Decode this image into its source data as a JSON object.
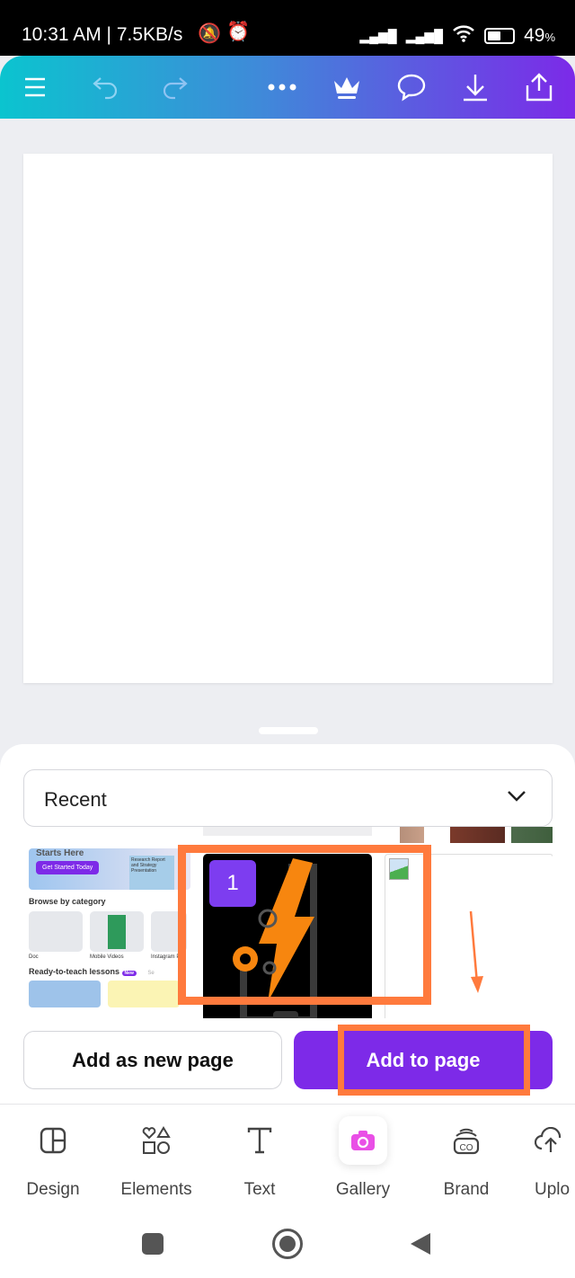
{
  "status_bar": {
    "time": "10:31 AM | 7.5KB/s",
    "battery": "49",
    "battery_unit": "%"
  },
  "toolbar": {
    "icons": [
      "menu-icon",
      "undo-icon",
      "redo-icon",
      "more-icon",
      "crown-icon",
      "comment-icon",
      "download-icon",
      "share-icon"
    ]
  },
  "panel": {
    "dropdown_value": "Recent",
    "thumb1": {
      "heading": "Starts Here",
      "cta": "Get Started Today",
      "card_text": "Research Report and Strategy Presentation",
      "browse": "Browse by category",
      "categories": [
        "Doc",
        "Mobile Videos",
        "Instagram Po"
      ],
      "lessons": "Ready-to-teach lessons",
      "lessons_badge": "New",
      "see_all": "Se"
    },
    "selected_badge": "1",
    "add_new_page": "Add as new page",
    "add_to_page": "Add to page"
  },
  "colors": {
    "accent": "#7d2ae8",
    "highlight": "#ff7a3d",
    "gallery": "#e94fe6"
  },
  "bottom_nav": [
    {
      "label": "Design",
      "icon": "design-icon"
    },
    {
      "label": "Elements",
      "icon": "elements-icon"
    },
    {
      "label": "Text",
      "icon": "text-icon"
    },
    {
      "label": "Gallery",
      "icon": "camera-icon"
    },
    {
      "label": "Brand",
      "icon": "brand-icon"
    },
    {
      "label": "Uplo",
      "icon": "upload-icon"
    }
  ]
}
